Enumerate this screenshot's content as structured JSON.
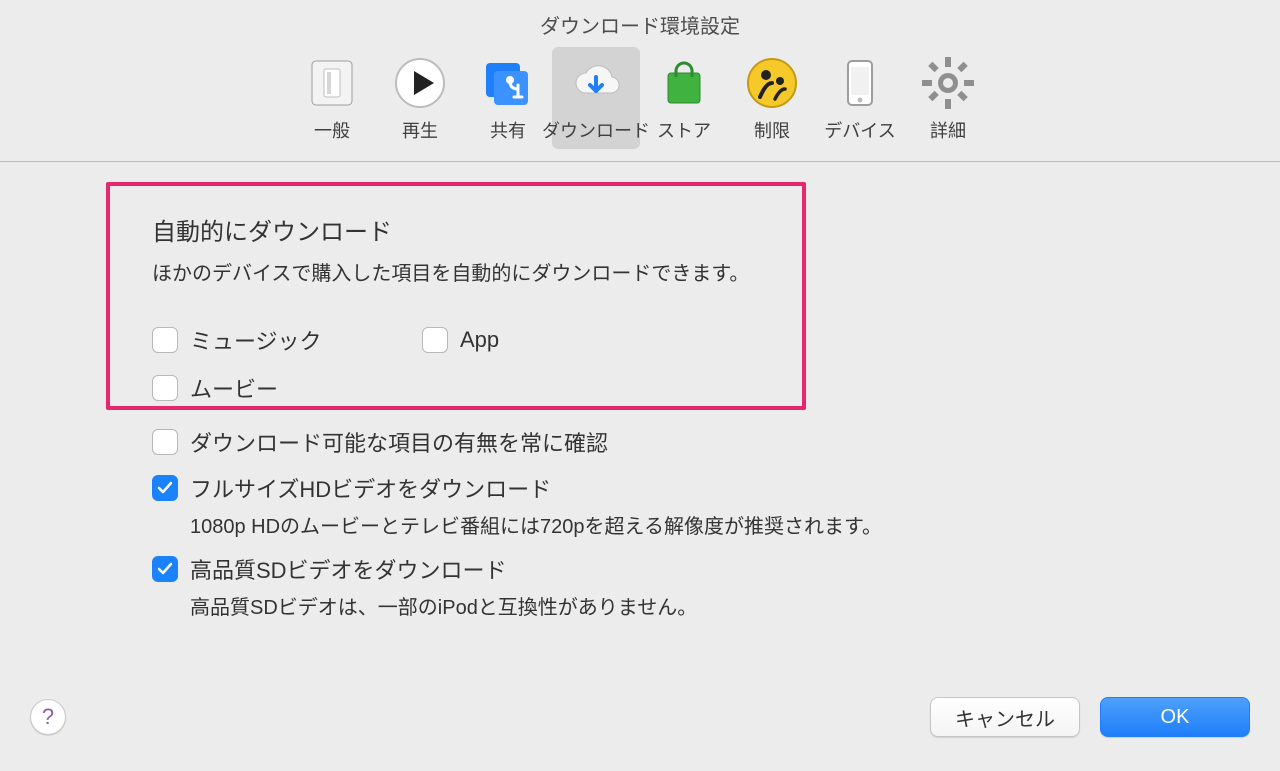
{
  "window": {
    "title": "ダウンロード環境設定"
  },
  "toolbar": {
    "items": [
      {
        "label": "一般"
      },
      {
        "label": "再生"
      },
      {
        "label": "共有"
      },
      {
        "label": "ダウンロード"
      },
      {
        "label": "ストア"
      },
      {
        "label": "制限"
      },
      {
        "label": "デバイス"
      },
      {
        "label": "詳細"
      }
    ]
  },
  "auto": {
    "title": "自動的にダウンロード",
    "subtitle": "ほかのデバイスで購入した項目を自動的にダウンロードできます。",
    "options": {
      "music": "ミュージック",
      "app": "App",
      "movies": "ムービー"
    }
  },
  "options": {
    "checkAvailable": "ダウンロード可能な項目の有無を常に確認",
    "fullHD": "フルサイズHDビデオをダウンロード",
    "fullHDHint": "1080p HDのムービーとテレビ番組には720pを超える解像度が推奨されます。",
    "hqSD": "高品質SDビデオをダウンロード",
    "hqSDHint": "高品質SDビデオは、一部のiPodと互換性がありません。"
  },
  "footer": {
    "help": "?",
    "cancel": "キャンセル",
    "ok": "OK"
  }
}
